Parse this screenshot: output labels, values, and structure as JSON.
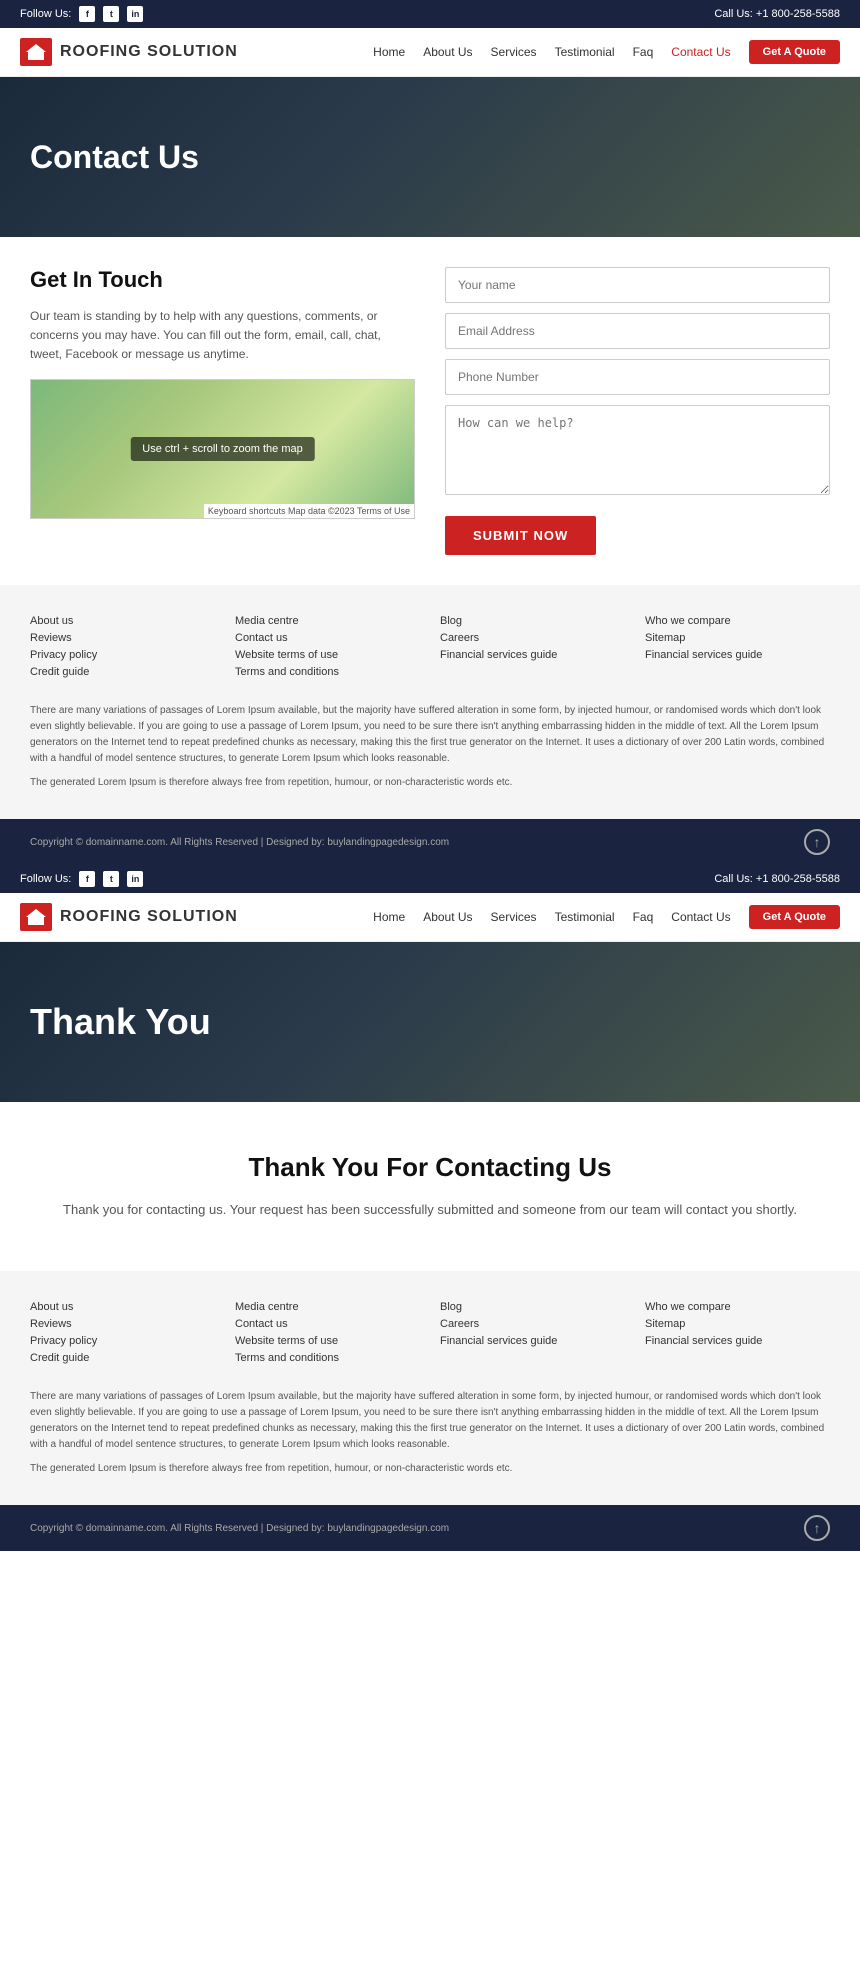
{
  "page1": {
    "topbar": {
      "follow_label": "Follow Us:",
      "call_label": "Call Us:",
      "phone": "+1 800-258-5588",
      "socials": [
        "f",
        "t",
        "in"
      ]
    },
    "header": {
      "logo_text": "ROOFING SOLUTION",
      "nav": [
        {
          "label": "Home",
          "active": false
        },
        {
          "label": "About Us",
          "active": false
        },
        {
          "label": "Services",
          "active": false
        },
        {
          "label": "Testimonial",
          "active": false
        },
        {
          "label": "Faq",
          "active": false
        },
        {
          "label": "Contact Us",
          "active": true
        }
      ],
      "cta_label": "Get A Quote"
    },
    "hero": {
      "title": "Contact Us"
    },
    "contact": {
      "title": "Get In Touch",
      "description": "Our team is standing by to help with any questions, comments, or concerns you may have. You can fill out the form, email, call, chat, tweet, Facebook or message us anytime.",
      "map_hint": "Use ctrl + scroll to zoom the map",
      "map_footer": "Keyboard shortcuts  Map data ©2023  Terms of Use",
      "form": {
        "name_placeholder": "Your name",
        "email_placeholder": "Email Address",
        "phone_placeholder": "Phone Number",
        "message_placeholder": "How can we help?",
        "submit_label": "SUBMIT NOW"
      }
    },
    "footer": {
      "cols": [
        {
          "links": [
            "About us",
            "Reviews",
            "Privacy policy",
            "Credit guide"
          ]
        },
        {
          "links": [
            "Media centre",
            "Contact us",
            "Website terms of use",
            "Terms and conditions"
          ]
        },
        {
          "links": [
            "Blog",
            "Careers",
            "Financial services guide"
          ]
        },
        {
          "links": [
            "Who we compare",
            "Sitemap",
            "Financial services guide"
          ]
        }
      ],
      "body_text": "There are many variations of passages of Lorem Ipsum available, but the majority have suffered alteration in some form, by injected humour, or randomised words which don't look even slightly believable. If you are going to use a passage of Lorem Ipsum, you need to be sure there isn't anything embarrassing hidden in the middle of text. All the Lorem Ipsum generators on the Internet tend to repeat predefined chunks as necessary, making this the first true generator on the Internet. It uses a dictionary of over 200 Latin words, combined with a handful of model sentence structures, to generate Lorem Ipsum which looks reasonable.",
      "generated_text": "The generated Lorem Ipsum is therefore always free from repetition, humour, or non-characteristic words etc.",
      "copyright": "Copyright © domainname.com. All Rights Reserved | Designed by: buylandingpagedesign.com"
    }
  },
  "page2": {
    "topbar": {
      "follow_label": "Follow Us:",
      "call_label": "Call Us:",
      "phone": "+1 800-258-5588",
      "socials": [
        "f",
        "t",
        "in"
      ]
    },
    "header": {
      "logo_text": "ROOFING SOLUTION",
      "nav": [
        {
          "label": "Home",
          "active": false
        },
        {
          "label": "About Us",
          "active": false
        },
        {
          "label": "Services",
          "active": false
        },
        {
          "label": "Testimonial",
          "active": false
        },
        {
          "label": "Faq",
          "active": false
        },
        {
          "label": "Contact Us",
          "active": false
        }
      ],
      "cta_label": "Get A Quote"
    },
    "hero": {
      "title": "Thank You"
    },
    "content": {
      "title": "Thank You For Contacting Us",
      "message": "Thank you for contacting us. Your request has been successfully submitted and someone from our team will contact you shortly."
    },
    "footer": {
      "cols": [
        {
          "links": [
            "About us",
            "Reviews",
            "Privacy policy",
            "Credit guide"
          ]
        },
        {
          "links": [
            "Media centre",
            "Contact us",
            "Website terms of use",
            "Terms and conditions"
          ]
        },
        {
          "links": [
            "Blog",
            "Careers",
            "Financial services guide"
          ]
        },
        {
          "links": [
            "Who we compare",
            "Sitemap",
            "Financial services guide"
          ]
        }
      ],
      "body_text": "There are many variations of passages of Lorem Ipsum available, but the majority have suffered alteration in some form, by injected humour, or randomised words which don't look even slightly believable. If you are going to use a passage of Lorem Ipsum, you need to be sure there isn't anything embarrassing hidden in the middle of text. All the Lorem Ipsum generators on the Internet tend to repeat predefined chunks as necessary, making this the first true generator on the Internet. It uses a dictionary of over 200 Latin words, combined with a handful of model sentence structures, to generate Lorem Ipsum which looks reasonable.",
      "generated_text": "The generated Lorem Ipsum is therefore always free from repetition, humour, or non-characteristic words etc.",
      "copyright": "Copyright © domainname.com. All Rights Reserved | Designed by: buylandingpagedesign.com"
    }
  }
}
